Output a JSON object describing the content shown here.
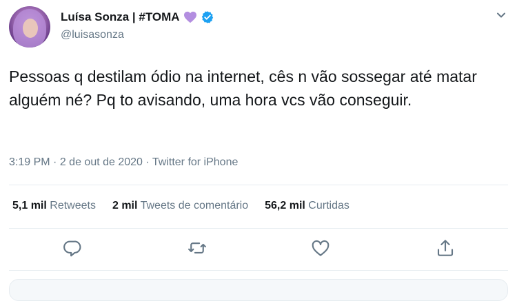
{
  "author": {
    "display_name": "Luísa Sonza | #TOMA",
    "handle": "@luisasonza",
    "verified": true,
    "name_emoji": "purple-heart-icon"
  },
  "tweet": {
    "text": "Pessoas q destilam ódio na internet, cês n vão sossegar até matar alguém né? Pq to avisando, uma hora vcs vão conseguir.",
    "time": "3:19 PM",
    "separator": "·",
    "date": "2 de out de 2020",
    "source": "Twitter for iPhone"
  },
  "stats": {
    "retweets_count": "5,1 mil",
    "retweets_label": "Retweets",
    "quotes_count": "2 mil",
    "quotes_label": "Tweets de comentário",
    "likes_count": "56,2 mil",
    "likes_label": "Curtidas"
  },
  "colors": {
    "text_primary": "#14171a",
    "text_secondary": "#657786",
    "accent": "#1da1f2",
    "divider": "#e6ecf0",
    "heart_purple": "#b38ee0"
  },
  "icons": [
    "caret-down-icon",
    "reply-icon",
    "retweet-icon",
    "like-icon",
    "share-icon",
    "verified-badge-icon"
  ]
}
